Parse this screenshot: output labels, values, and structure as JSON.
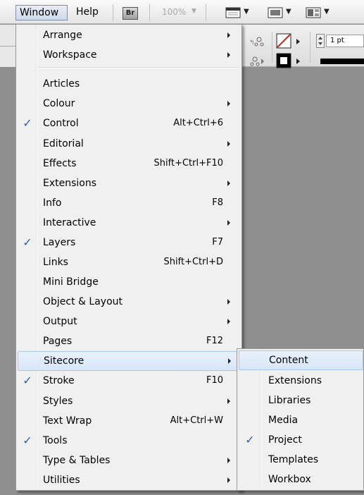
{
  "menubar": {
    "window_label": "Window",
    "help_label": "Help",
    "bridge_label": "Br",
    "zoom_value": "100%"
  },
  "control_panel": {
    "stroke_weight": "1 pt"
  },
  "menu": {
    "items": [
      {
        "label": "Arrange",
        "shortcut": "",
        "checked": false,
        "submenu": true
      },
      {
        "label": "Workspace",
        "shortcut": "",
        "checked": false,
        "submenu": true
      },
      {
        "label": "Articles",
        "shortcut": "",
        "checked": false,
        "submenu": false
      },
      {
        "label": "Colour",
        "shortcut": "",
        "checked": false,
        "submenu": true
      },
      {
        "label": "Control",
        "shortcut": "Alt+Ctrl+6",
        "checked": true,
        "submenu": false
      },
      {
        "label": "Editorial",
        "shortcut": "",
        "checked": false,
        "submenu": true
      },
      {
        "label": "Effects",
        "shortcut": "Shift+Ctrl+F10",
        "checked": false,
        "submenu": false
      },
      {
        "label": "Extensions",
        "shortcut": "",
        "checked": false,
        "submenu": true
      },
      {
        "label": "Info",
        "shortcut": "F8",
        "checked": false,
        "submenu": false
      },
      {
        "label": "Interactive",
        "shortcut": "",
        "checked": false,
        "submenu": true
      },
      {
        "label": "Layers",
        "shortcut": "F7",
        "checked": true,
        "submenu": false
      },
      {
        "label": "Links",
        "shortcut": "Shift+Ctrl+D",
        "checked": false,
        "submenu": false
      },
      {
        "label": "Mini Bridge",
        "shortcut": "",
        "checked": false,
        "submenu": false
      },
      {
        "label": "Object & Layout",
        "shortcut": "",
        "checked": false,
        "submenu": true
      },
      {
        "label": "Output",
        "shortcut": "",
        "checked": false,
        "submenu": true
      },
      {
        "label": "Pages",
        "shortcut": "F12",
        "checked": false,
        "submenu": false
      },
      {
        "label": "Sitecore",
        "shortcut": "",
        "checked": false,
        "submenu": true
      },
      {
        "label": "Stroke",
        "shortcut": "F10",
        "checked": true,
        "submenu": false
      },
      {
        "label": "Styles",
        "shortcut": "",
        "checked": false,
        "submenu": true
      },
      {
        "label": "Text Wrap",
        "shortcut": "Alt+Ctrl+W",
        "checked": false,
        "submenu": false
      },
      {
        "label": "Tools",
        "shortcut": "",
        "checked": true,
        "submenu": false
      },
      {
        "label": "Type & Tables",
        "shortcut": "",
        "checked": false,
        "submenu": true
      },
      {
        "label": "Utilities",
        "shortcut": "",
        "checked": false,
        "submenu": true
      }
    ],
    "check_glyph": "✓"
  },
  "sitecore_submenu": {
    "items": [
      {
        "label": "Content",
        "checked": false
      },
      {
        "label": "Extensions",
        "checked": false
      },
      {
        "label": "Libraries",
        "checked": false
      },
      {
        "label": "Media",
        "checked": false
      },
      {
        "label": "Project",
        "checked": true
      },
      {
        "label": "Templates",
        "checked": false
      },
      {
        "label": "Workbox",
        "checked": false
      }
    ]
  },
  "colors": {
    "check": "#2a5fc0",
    "highlight_border": "#a8c7ec",
    "menu_bg": "#f0f0f0",
    "canvas_bg": "#8f8f8f"
  }
}
